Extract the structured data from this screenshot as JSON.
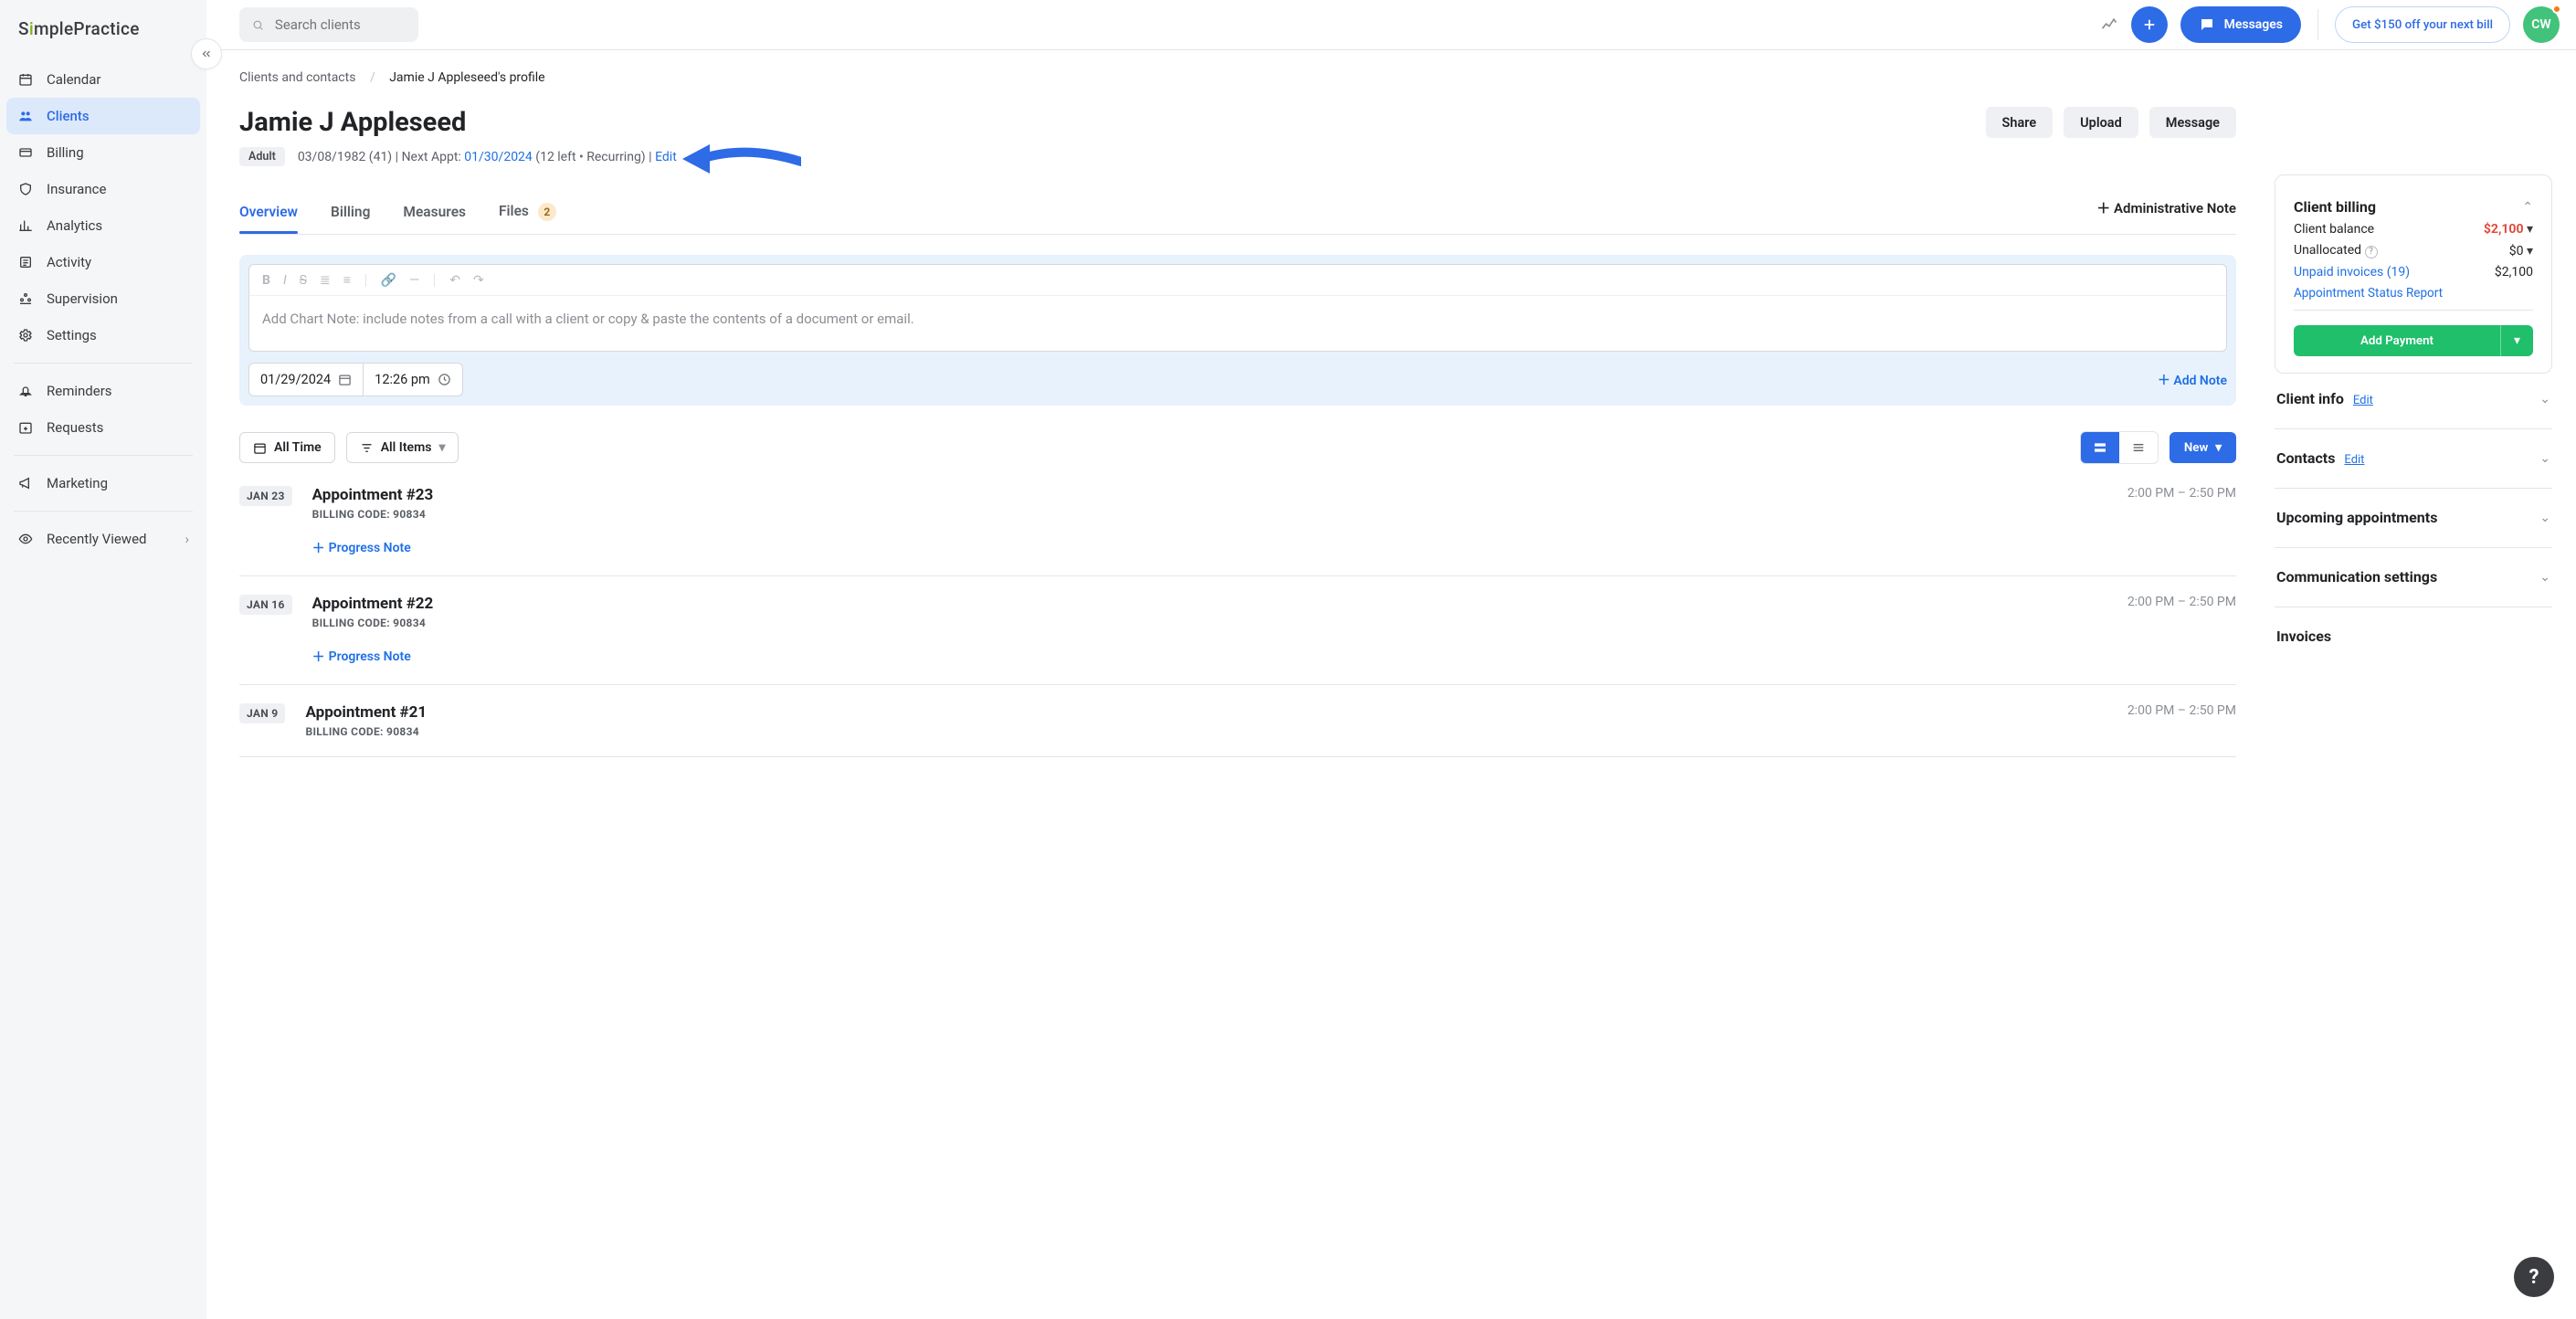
{
  "brand": "SimplePractice",
  "search": {
    "placeholder": "Search clients"
  },
  "topbar": {
    "messages": "Messages",
    "promo": "Get $150 off your next bill",
    "avatar_initials": "CW"
  },
  "sidebar": {
    "items": [
      {
        "label": "Calendar"
      },
      {
        "label": "Clients"
      },
      {
        "label": "Billing"
      },
      {
        "label": "Insurance"
      },
      {
        "label": "Analytics"
      },
      {
        "label": "Activity"
      },
      {
        "label": "Supervision"
      },
      {
        "label": "Settings"
      }
    ],
    "secondary": [
      {
        "label": "Reminders"
      },
      {
        "label": "Requests"
      }
    ],
    "marketing": "Marketing",
    "recent": "Recently Viewed"
  },
  "crumbs": {
    "root": "Clients and contacts",
    "current": "Jamie J Appleseed's profile"
  },
  "client": {
    "name": "Jamie J Appleseed",
    "badge": "Adult",
    "dob": "03/08/1982 (41)",
    "next_label": "Next Appt:",
    "next_date": "01/30/2024",
    "next_tail": "(12 left • Recurring)",
    "edit": "Edit"
  },
  "actions": {
    "share": "Share",
    "upload": "Upload",
    "message": "Message"
  },
  "tabs": {
    "overview": "Overview",
    "billing": "Billing",
    "measures": "Measures",
    "files": "Files",
    "files_count": "2",
    "admin_note": "Administrative Note"
  },
  "note": {
    "placeholder": "Add Chart Note: include notes from a call with a client or copy & paste the contents of a document or email.",
    "date": "01/29/2024",
    "time": "12:26 pm",
    "add": "Add Note"
  },
  "filters": {
    "all_time": "All Time",
    "all_items": "All Items",
    "new": "New"
  },
  "appointments": [
    {
      "date": "JAN 23",
      "title": "Appointment #23",
      "code": "BILLING CODE: 90834",
      "time": "2:00 PM – 2:50 PM",
      "link": "Progress Note"
    },
    {
      "date": "JAN 16",
      "title": "Appointment #22",
      "code": "BILLING CODE: 90834",
      "time": "2:00 PM – 2:50 PM",
      "link": "Progress Note"
    },
    {
      "date": "JAN 9",
      "title": "Appointment #21",
      "code": "BILLING CODE: 90834",
      "time": "2:00 PM – 2:50 PM"
    }
  ],
  "billing": {
    "title": "Client billing",
    "balance_label": "Client balance",
    "balance": "$2,100",
    "unalloc_label": "Unallocated",
    "unalloc": "$0",
    "unpaid_label": "Unpaid invoices (19)",
    "unpaid": "$2,100",
    "report": "Appointment Status Report",
    "add_payment": "Add Payment"
  },
  "panels": {
    "client_info": "Client info",
    "edit": "Edit",
    "contacts": "Contacts",
    "upcoming": "Upcoming appointments",
    "comm": "Communication settings",
    "invoices": "Invoices"
  }
}
